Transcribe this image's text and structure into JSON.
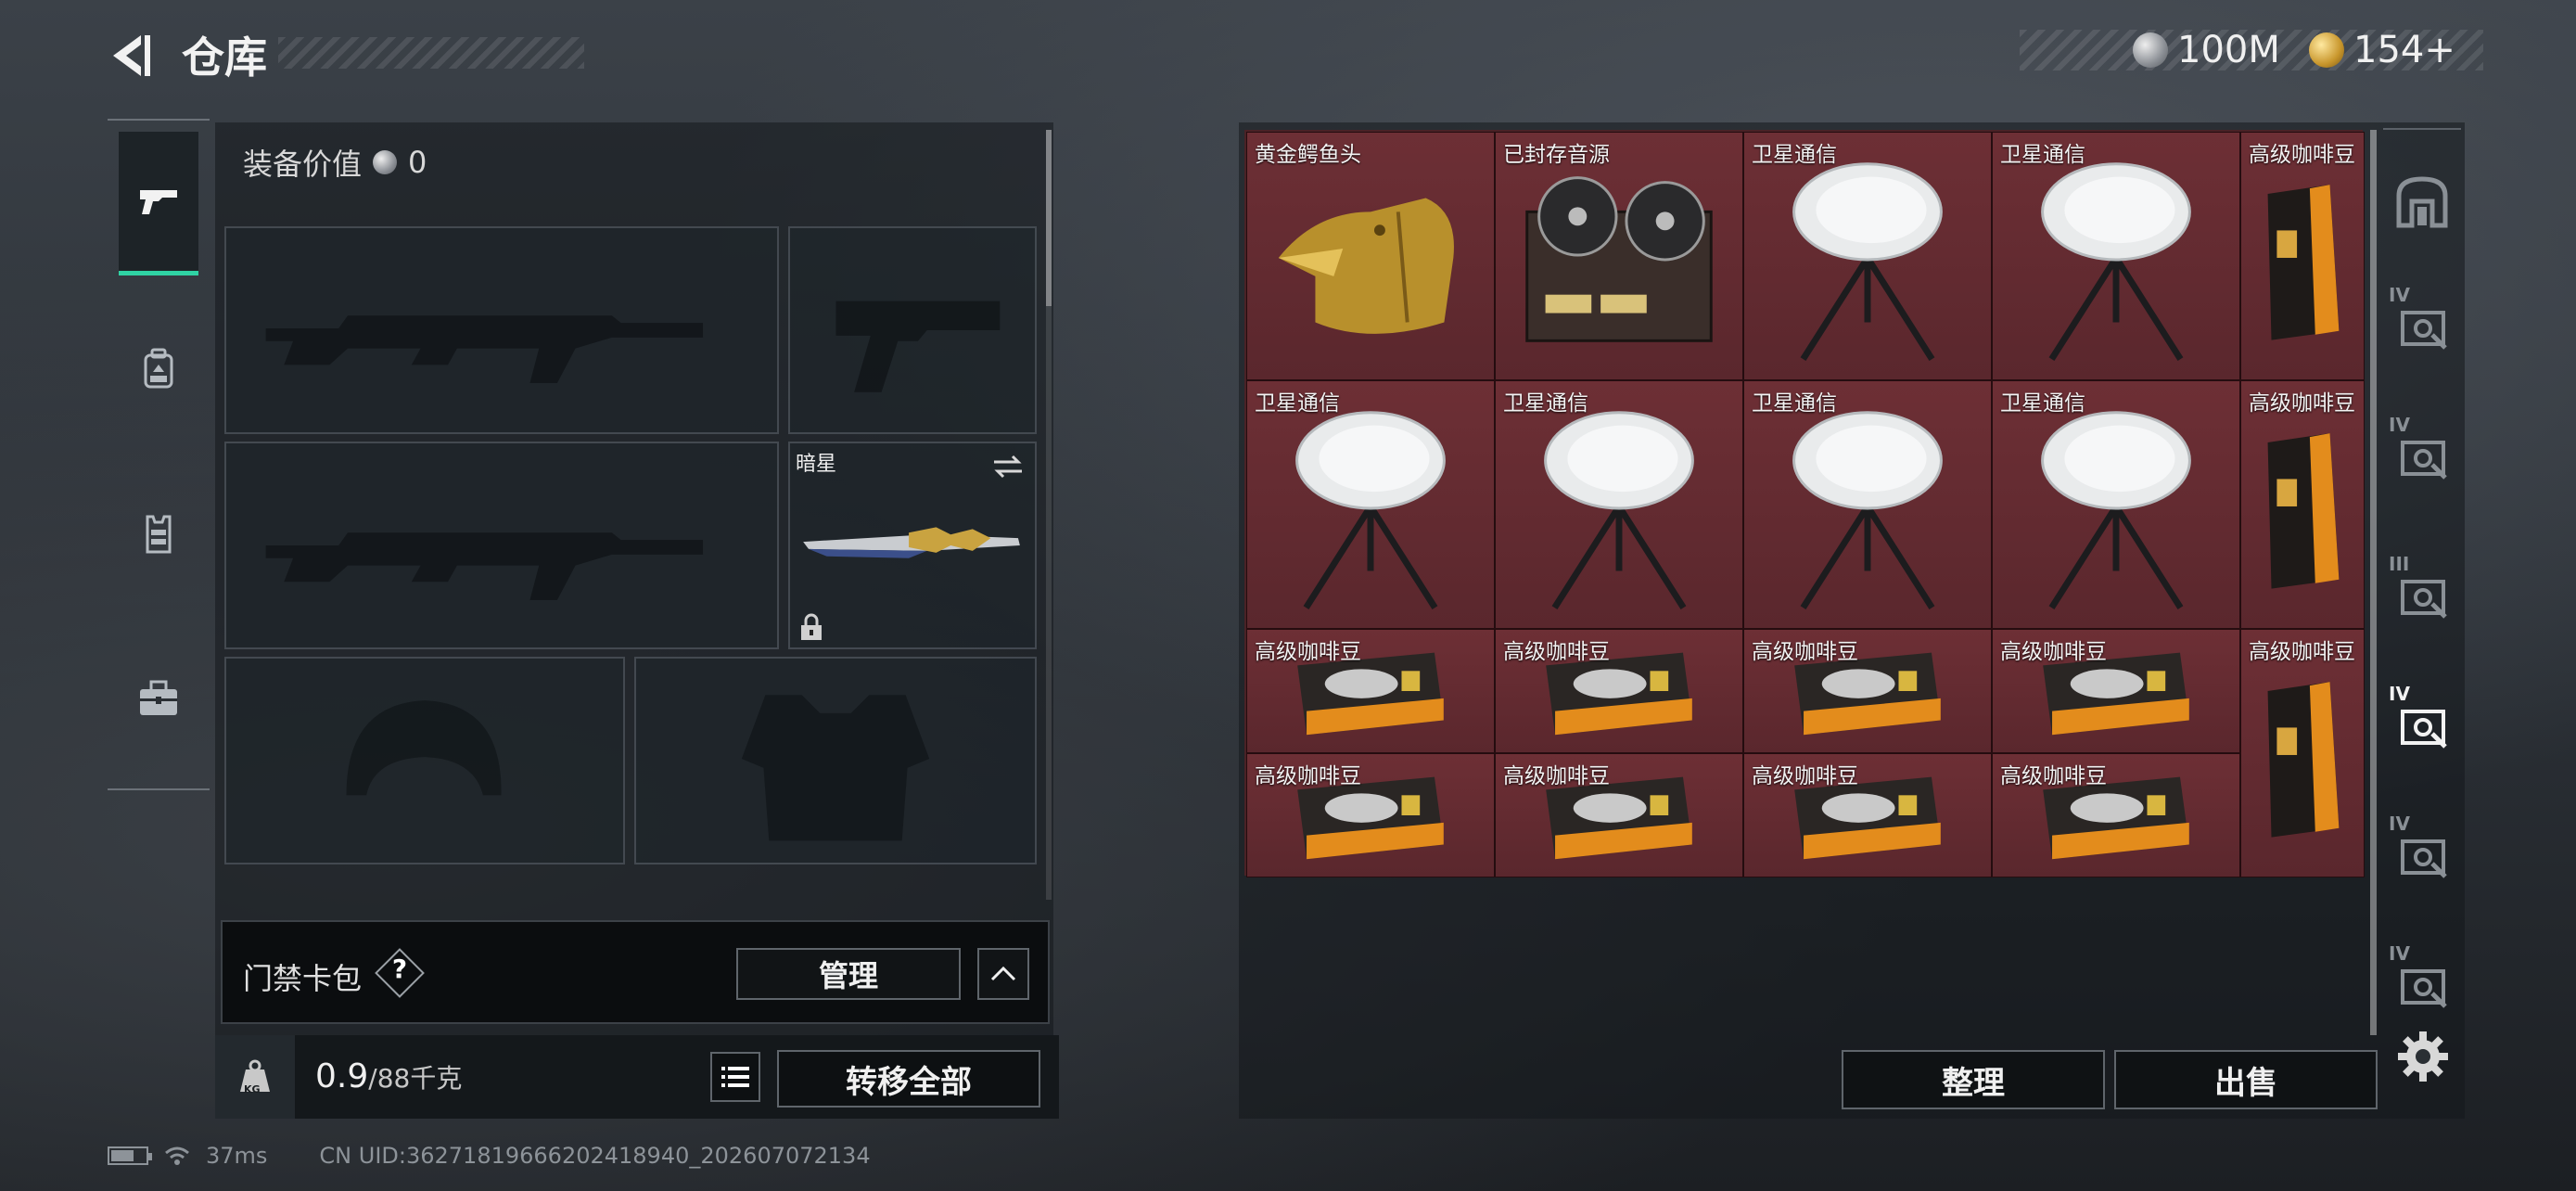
{
  "header": {
    "title": "仓库"
  },
  "currency": {
    "silver": "100M",
    "gold": "154+"
  },
  "categories": [
    "weapons",
    "backpack",
    "vest",
    "toolbox"
  ],
  "equipment": {
    "value_label": "装备价值",
    "value": "0",
    "melee_name": "暗星"
  },
  "keycard": {
    "label": "门禁卡包",
    "help": "?",
    "manage_label": "管理"
  },
  "capacity": {
    "current": "0.9",
    "max": "/88千克",
    "kg_icon_text": "KG",
    "transfer_all_label": "转移全部"
  },
  "storage": {
    "items": [
      {
        "name": "黄金鳄鱼头",
        "icon": "golden-croc-head"
      },
      {
        "name": "已封存音源",
        "icon": "reel-tape-recorder"
      },
      {
        "name": "卫星通信",
        "icon": "satellite-dish"
      },
      {
        "name": "卫星通信",
        "icon": "satellite-dish"
      },
      {
        "name": "高级咖啡豆",
        "icon": "coffee-bag-upright"
      },
      {
        "name": "卫星通信",
        "icon": "satellite-dish"
      },
      {
        "name": "卫星通信",
        "icon": "satellite-dish"
      },
      {
        "name": "卫星通信",
        "icon": "satellite-dish"
      },
      {
        "name": "卫星通信",
        "icon": "satellite-dish"
      },
      {
        "name": "高级咖啡豆",
        "icon": "coffee-bag-upright"
      },
      {
        "name": "高级咖啡豆",
        "icon": "coffee-bag-flat"
      },
      {
        "name": "高级咖啡豆",
        "icon": "coffee-bag-flat"
      },
      {
        "name": "高级咖啡豆",
        "icon": "coffee-bag-flat"
      },
      {
        "name": "高级咖啡豆",
        "icon": "coffee-bag-flat"
      },
      {
        "name": "高级咖啡豆",
        "icon": "coffee-bag-upright"
      },
      {
        "name": "高级咖啡豆",
        "icon": "coffee-bag-flat"
      },
      {
        "name": "高级咖啡豆",
        "icon": "coffee-bag-flat"
      },
      {
        "name": "高级咖啡豆",
        "icon": "coffee-bag-flat"
      },
      {
        "name": "高级咖啡豆",
        "icon": "coffee-bag-flat"
      }
    ],
    "sort_label": "整理",
    "sell_label": "出售"
  },
  "container_tabs": [
    {
      "icon": "safehouse-icon",
      "tier": ""
    },
    {
      "icon": "container-icon",
      "tier": "IV"
    },
    {
      "icon": "container-icon",
      "tier": "IV"
    },
    {
      "icon": "container-icon",
      "tier": "III"
    },
    {
      "icon": "container-icon",
      "tier": "IV"
    },
    {
      "icon": "container-icon",
      "tier": "IV"
    },
    {
      "icon": "container-icon",
      "tier": "IV"
    }
  ],
  "footer": {
    "ping": "37ms",
    "uid": "CN UID:3627181966620241894​0_202607072134"
  },
  "colors": {
    "accent": "#2fd3a4",
    "cell_red": "#5f2a30"
  }
}
